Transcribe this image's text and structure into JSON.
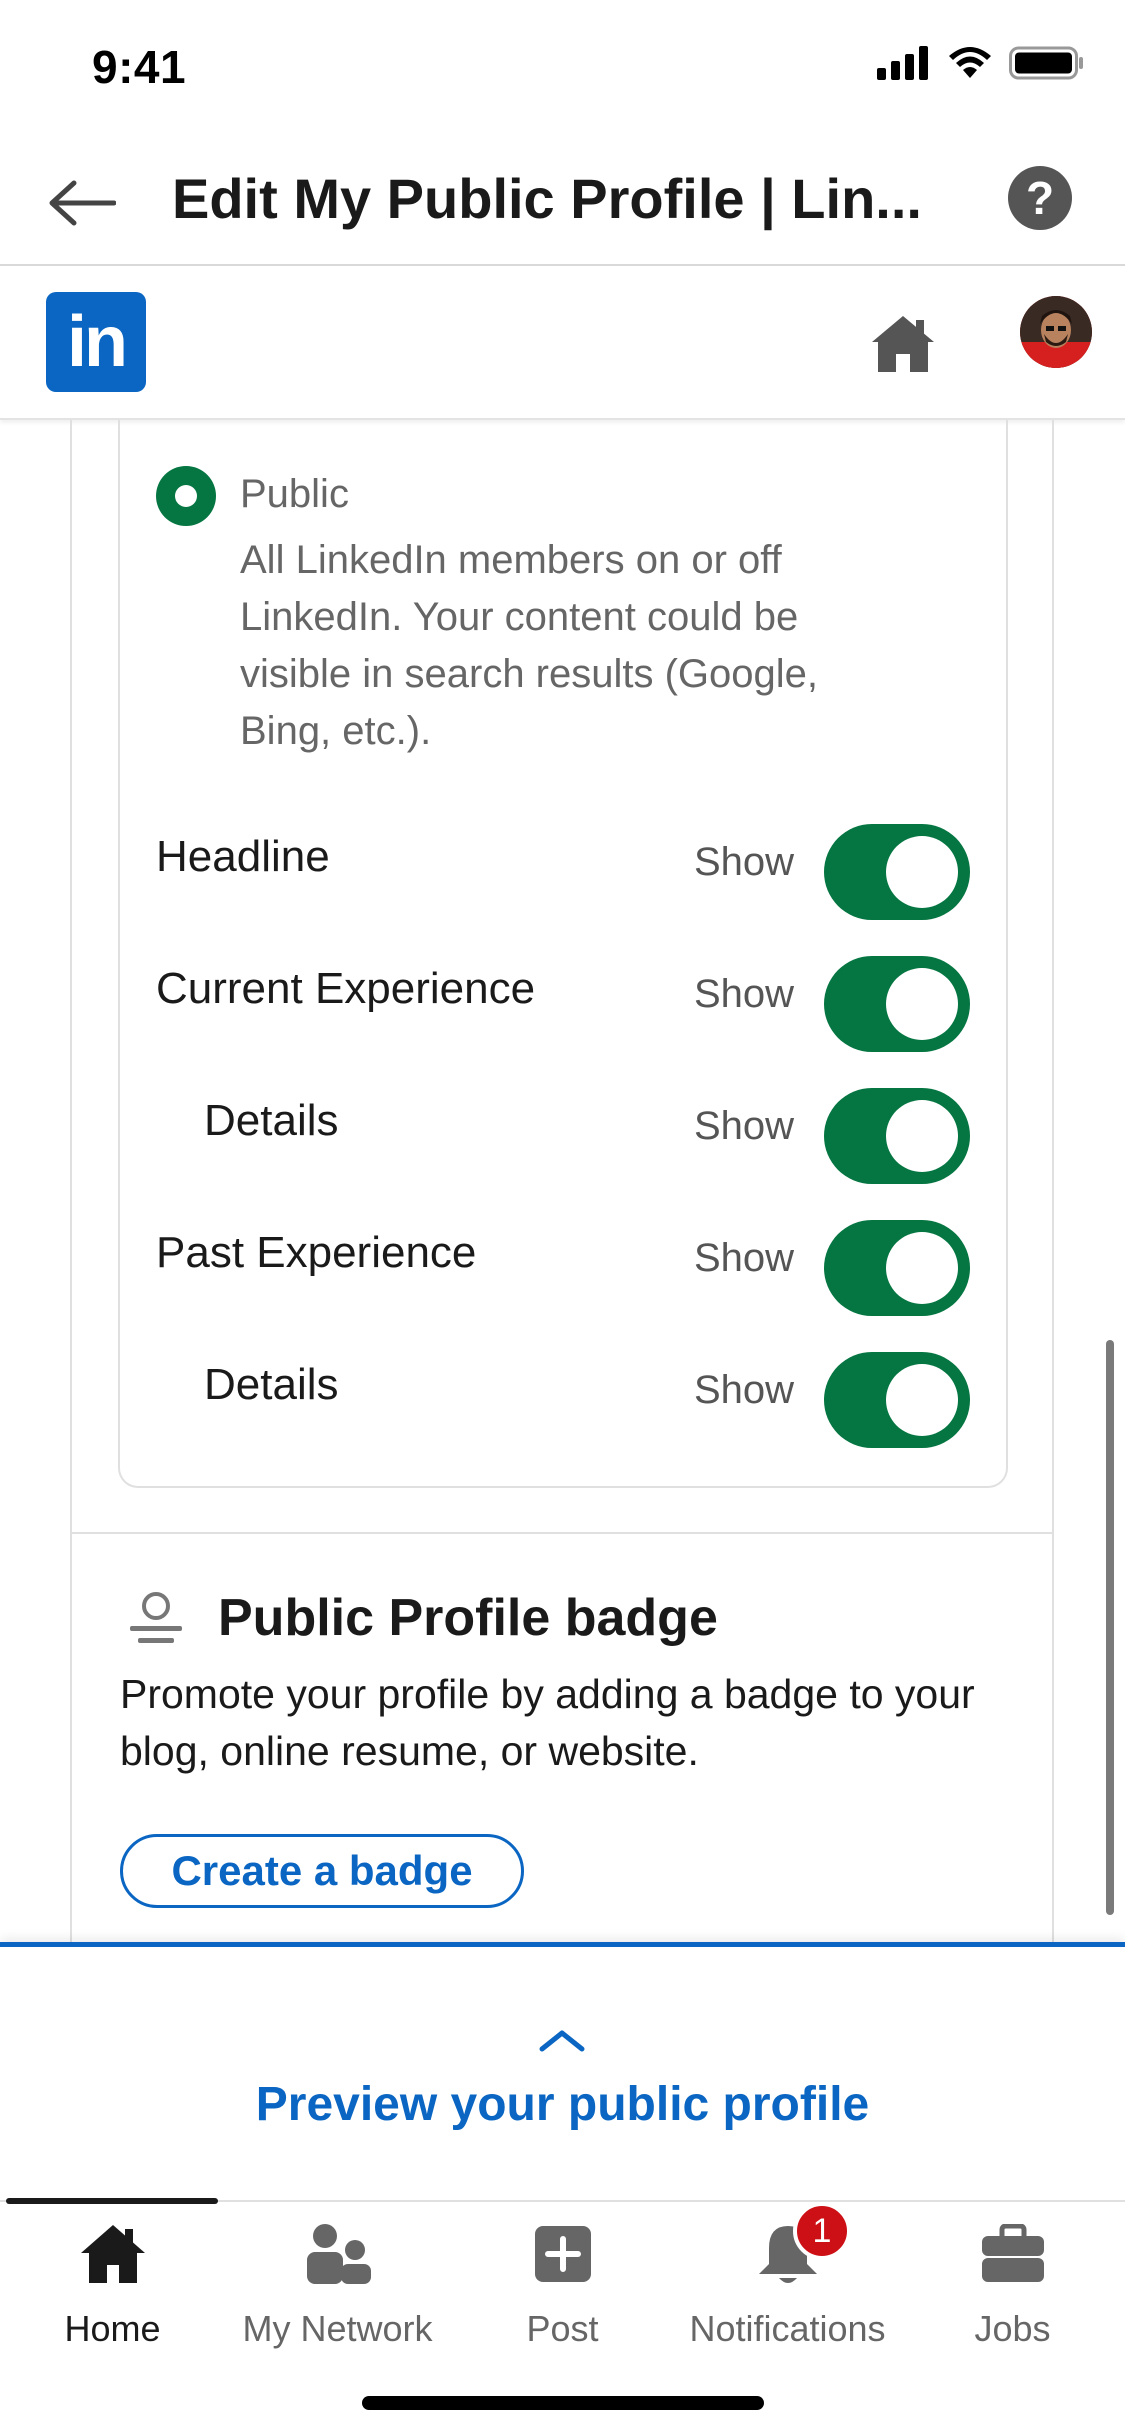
{
  "status_bar": {
    "time": "9:41",
    "icons": [
      "cellular-signal-icon",
      "wifi-icon",
      "battery-icon"
    ]
  },
  "nav": {
    "title": "Edit My Public Profile | Lin...",
    "back_icon": "back-arrow-icon",
    "help_icon": "help-icon",
    "help_glyph": "?"
  },
  "linkedin_bar": {
    "logo_text": "in",
    "home_icon": "home-icon",
    "avatar": "profile-avatar"
  },
  "visibility": {
    "option_label": "Public",
    "option_description": "All LinkedIn members on or off LinkedIn. Your content could be visible in search results (Google, Bing, etc.).",
    "selected": true
  },
  "toggles": [
    {
      "label": "Headline",
      "state": "Show",
      "on": true,
      "indent": false
    },
    {
      "label": "Current Experience",
      "state": "Show",
      "on": true,
      "indent": false
    },
    {
      "label": "Details",
      "state": "Show",
      "on": true,
      "indent": true
    },
    {
      "label": "Past Experience",
      "state": "Show",
      "on": true,
      "indent": false
    },
    {
      "label": "Details",
      "state": "Show",
      "on": true,
      "indent": true
    }
  ],
  "badge_section": {
    "icon": "badge-icon",
    "title": "Public Profile badge",
    "description": "Promote your profile by adding a badge to your blog, online resume, or website.",
    "button_label": "Create a badge"
  },
  "preview": {
    "chevron_icon": "chevron-up-icon",
    "label": "Preview your public profile"
  },
  "tabs": [
    {
      "label": "Home",
      "icon": "home-icon",
      "active": true
    },
    {
      "label": "My Network",
      "icon": "network-icon",
      "active": false
    },
    {
      "label": "Post",
      "icon": "post-icon",
      "active": false
    },
    {
      "label": "Notifications",
      "icon": "bell-icon",
      "active": false,
      "badge": "1"
    },
    {
      "label": "Jobs",
      "icon": "briefcase-icon",
      "active": false
    }
  ],
  "colors": {
    "linkedin_blue": "#0a66c2",
    "toggle_green": "#057642",
    "badge_red": "#cc1016"
  }
}
